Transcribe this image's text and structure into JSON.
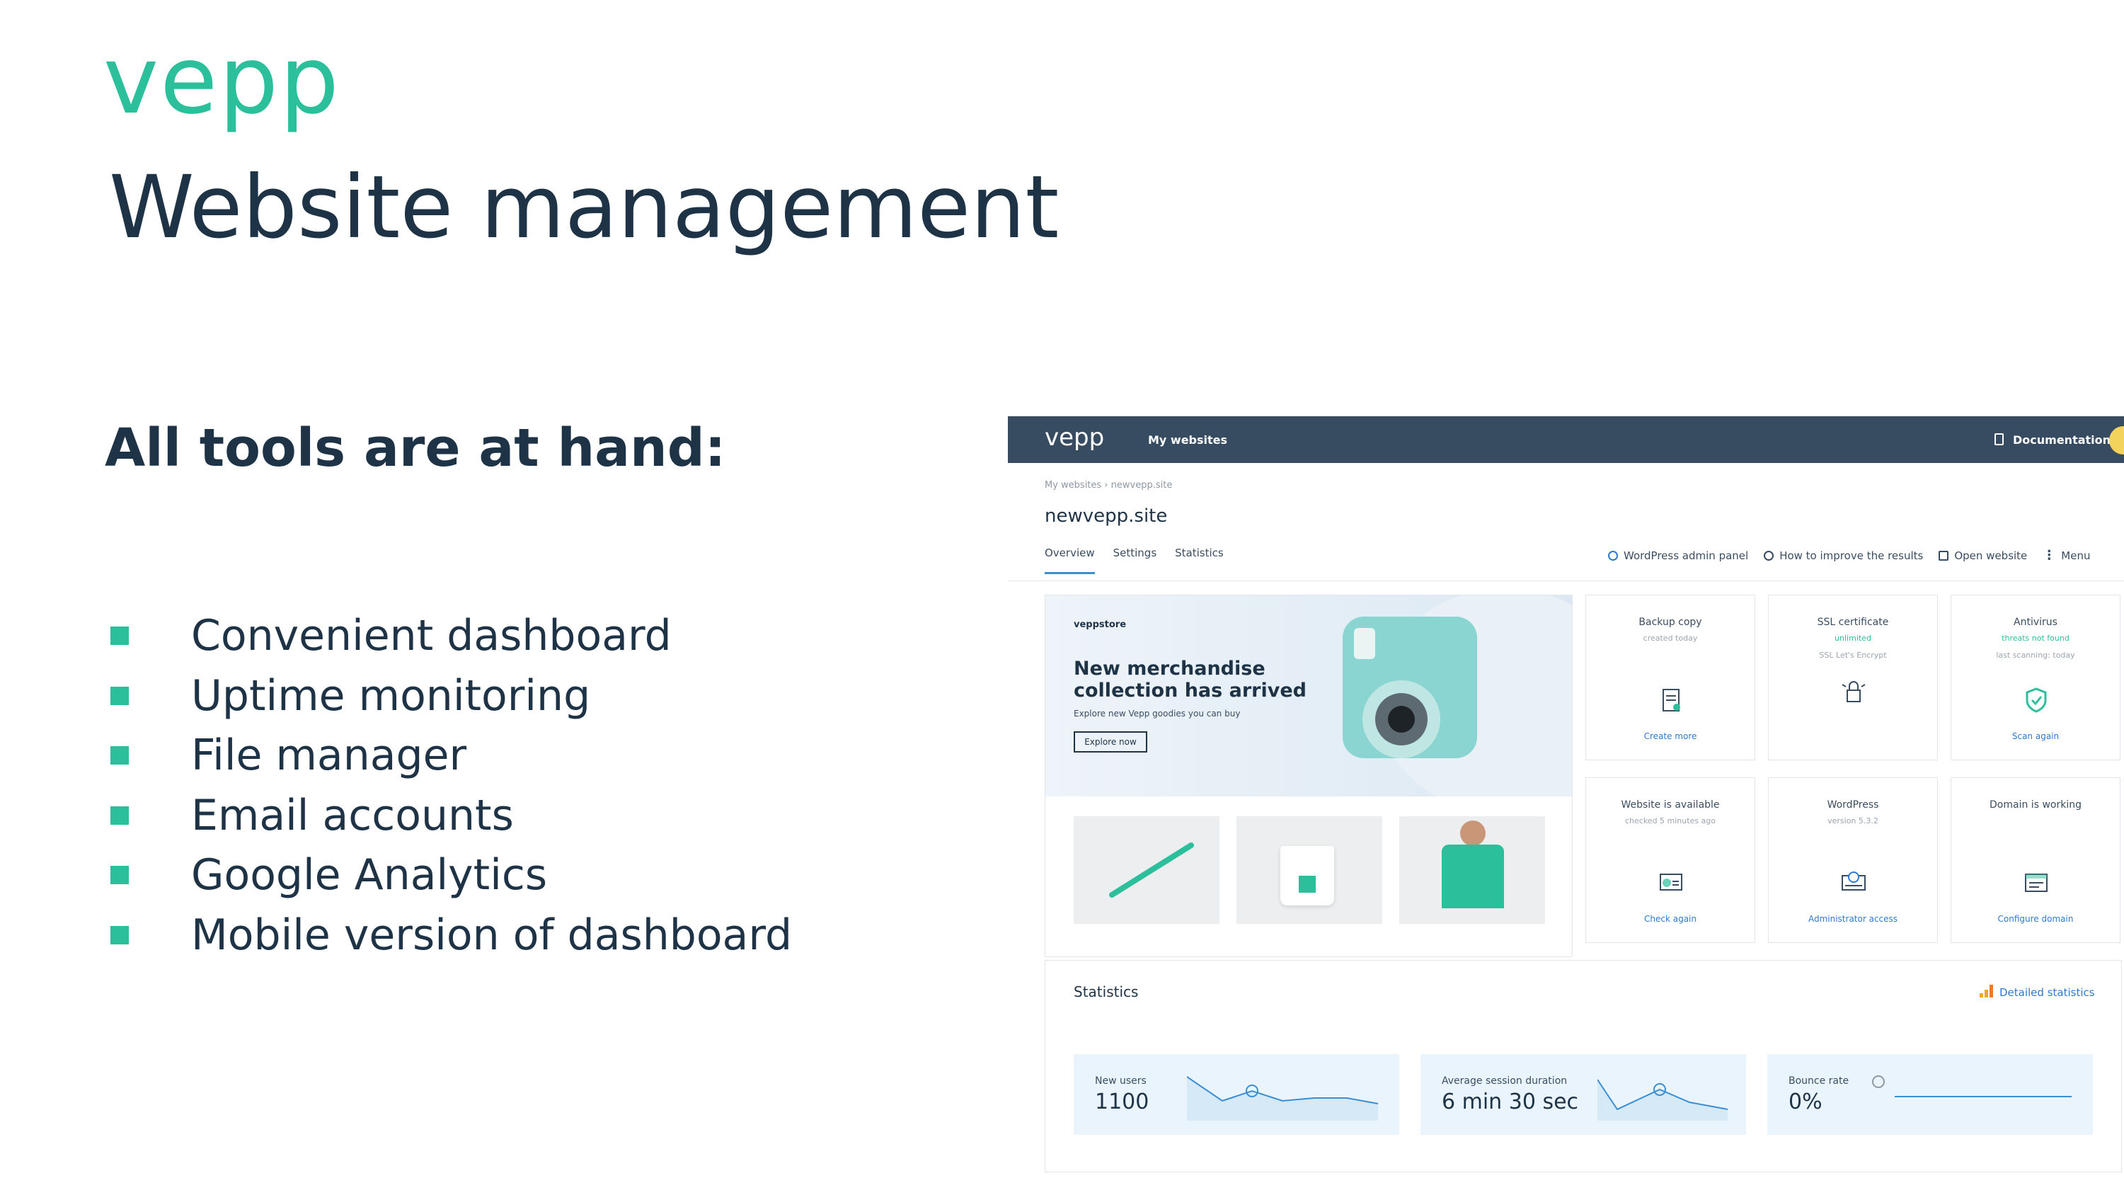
{
  "slide": {
    "logo": "vepp",
    "title": "Website management",
    "subtitle": "All tools are at hand:",
    "features": [
      "Convenient dashboard",
      "Uptime monitoring",
      "File manager",
      "Email accounts",
      "Google Analytics",
      "Mobile version of dashboard"
    ],
    "accent_color": "#2bbf9c",
    "text_color": "#1f3347"
  },
  "app": {
    "topbar": {
      "logo": "vepp",
      "nav_link": "My websites",
      "documentation": "Documentation",
      "background": "#374c61"
    },
    "breadcrumb": "My websites  ›  newvepp.site",
    "site_title": "newvepp.site",
    "tabs": [
      "Overview",
      "Settings",
      "Statistics"
    ],
    "actions": {
      "wp_admin": "WordPress admin panel",
      "improve": "How to improve the results",
      "open_site": "Open website",
      "menu": "Menu"
    },
    "promo": {
      "store": "veppstore",
      "headline": "New merchandise collection has arrived",
      "text": "Explore new Vepp goodies you can buy",
      "button": "Explore now"
    },
    "cards": [
      {
        "title": "Backup copy",
        "sub": "created today",
        "sub2": "",
        "link": "Create more",
        "icon": "document-icon"
      },
      {
        "title": "SSL certificate",
        "sub": "unlimited",
        "sub2": "SSL Let's Encrypt",
        "link": "",
        "icon": "lock-icon"
      },
      {
        "title": "Antivirus",
        "sub": "threats not found",
        "sub2": "last scanning: today",
        "link": "Scan again",
        "icon": "shield-icon"
      },
      {
        "title": "Website is available",
        "sub": "checked 5 minutes ago",
        "sub2": "",
        "link": "Check again",
        "icon": "monitor-icon"
      },
      {
        "title": "WordPress",
        "sub": "version 5.3.2",
        "sub2": "",
        "link": "Administrator access",
        "icon": "wordpress-icon"
      },
      {
        "title": "Domain is working",
        "sub": "",
        "sub2": "",
        "link": "Configure domain",
        "icon": "domain-icon"
      }
    ],
    "statistics": {
      "heading": "Statistics",
      "link": "Detailed statistics",
      "items": [
        {
          "label": "New users",
          "value": "1100"
        },
        {
          "label": "Average session duration",
          "value": "6 min 30 sec"
        },
        {
          "label": "Bounce rate",
          "value": "0%"
        }
      ]
    }
  }
}
